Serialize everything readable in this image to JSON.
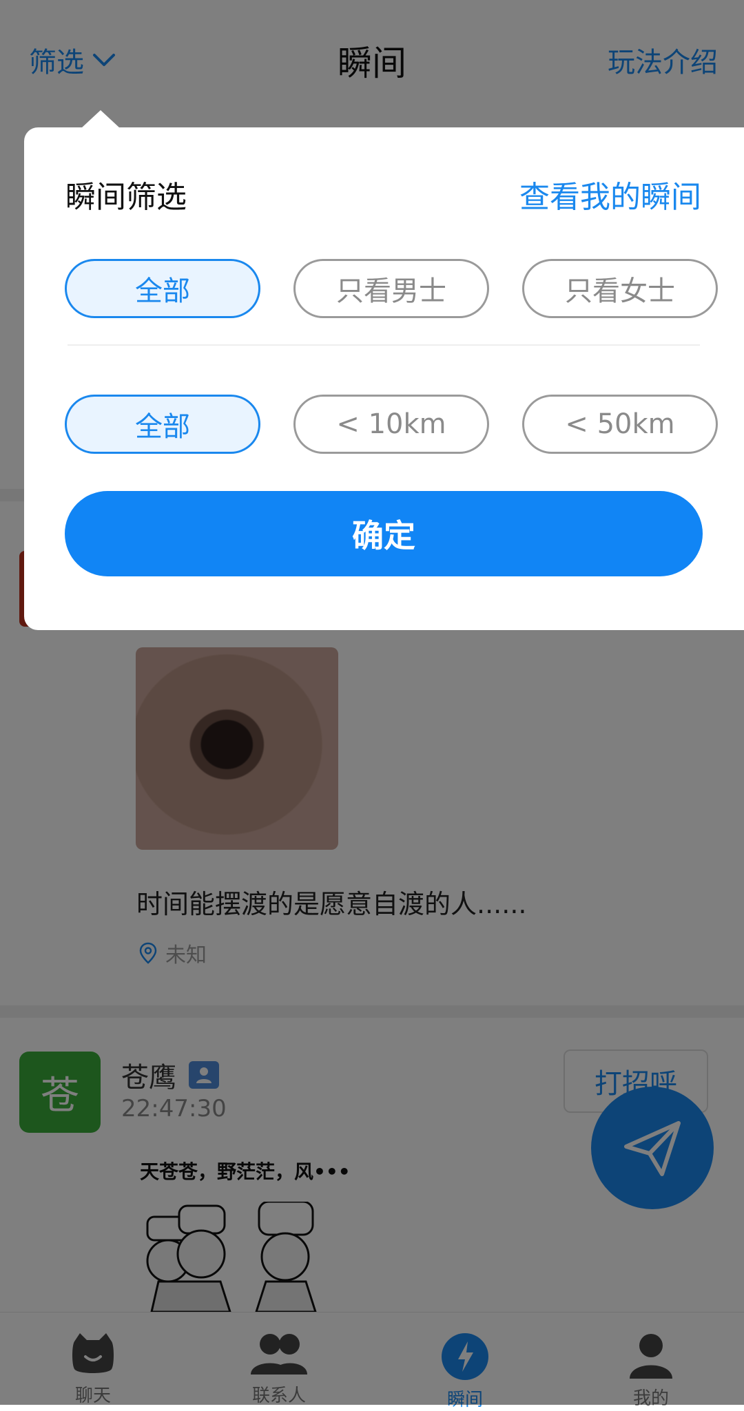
{
  "header": {
    "filter_label": "筛选",
    "title": "瞬间",
    "intro_link": "玩法介绍"
  },
  "feed": {
    "post1": {
      "text": "时间能摆渡的是愿意自渡的人......",
      "location": "未知"
    },
    "post2": {
      "avatar_char": "苍",
      "username": "苍鹰",
      "time": "22:47:30",
      "greet_button": "打招呼",
      "meme_caption": "天苍苍，野茫茫，风•••"
    }
  },
  "tabbar": {
    "tabs": [
      {
        "label": "聊天"
      },
      {
        "label": "联系人"
      },
      {
        "label": "瞬间"
      },
      {
        "label": "我的"
      }
    ],
    "active_index": 2
  },
  "filter_popup": {
    "title": "瞬间筛选",
    "my_moments_link": "查看我的瞬间",
    "gender_options": [
      "全部",
      "只看男士",
      "只看女士"
    ],
    "gender_selected": "全部",
    "distance_options": [
      "全部",
      "< 10km",
      "< 50km"
    ],
    "distance_selected": "全部",
    "confirm_label": "确定"
  },
  "colors": {
    "accent": "#1a88ee",
    "confirm": "#1185f5",
    "overlay": "rgba(0,0,0,0.5)",
    "avatar_green": "#3aac3a"
  },
  "icons": [
    "chevron-down-icon",
    "location-pin-icon",
    "user-badge-icon",
    "send-icon",
    "chat-icon",
    "contacts-icon",
    "lightning-icon",
    "profile-icon"
  ]
}
